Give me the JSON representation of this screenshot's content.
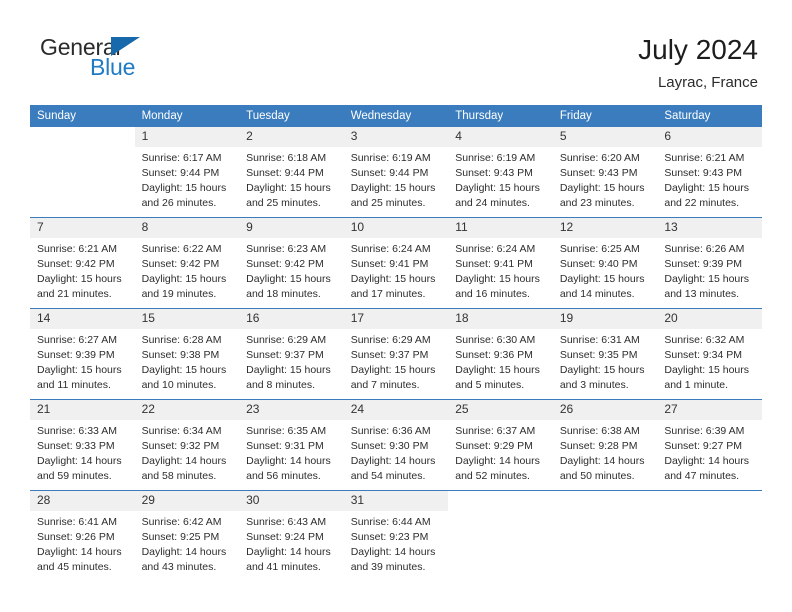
{
  "brand": {
    "name_part1": "General",
    "name_part2": "Blue"
  },
  "header": {
    "title": "July 2024",
    "location": "Layrac, France"
  },
  "colors": {
    "header_blue": "#3a7cbe",
    "logo_blue": "#1f7bc4",
    "daynum_bg": "#f0f0f0"
  },
  "weekday_headers": [
    "Sunday",
    "Monday",
    "Tuesday",
    "Wednesday",
    "Thursday",
    "Friday",
    "Saturday"
  ],
  "weeks": [
    [
      {
        "day": "",
        "sunrise": "",
        "sunset": "",
        "daylight": ""
      },
      {
        "day": "1",
        "sunrise": "Sunrise: 6:17 AM",
        "sunset": "Sunset: 9:44 PM",
        "daylight": "Daylight: 15 hours and 26 minutes."
      },
      {
        "day": "2",
        "sunrise": "Sunrise: 6:18 AM",
        "sunset": "Sunset: 9:44 PM",
        "daylight": "Daylight: 15 hours and 25 minutes."
      },
      {
        "day": "3",
        "sunrise": "Sunrise: 6:19 AM",
        "sunset": "Sunset: 9:44 PM",
        "daylight": "Daylight: 15 hours and 25 minutes."
      },
      {
        "day": "4",
        "sunrise": "Sunrise: 6:19 AM",
        "sunset": "Sunset: 9:43 PM",
        "daylight": "Daylight: 15 hours and 24 minutes."
      },
      {
        "day": "5",
        "sunrise": "Sunrise: 6:20 AM",
        "sunset": "Sunset: 9:43 PM",
        "daylight": "Daylight: 15 hours and 23 minutes."
      },
      {
        "day": "6",
        "sunrise": "Sunrise: 6:21 AM",
        "sunset": "Sunset: 9:43 PM",
        "daylight": "Daylight: 15 hours and 22 minutes."
      }
    ],
    [
      {
        "day": "7",
        "sunrise": "Sunrise: 6:21 AM",
        "sunset": "Sunset: 9:42 PM",
        "daylight": "Daylight: 15 hours and 21 minutes."
      },
      {
        "day": "8",
        "sunrise": "Sunrise: 6:22 AM",
        "sunset": "Sunset: 9:42 PM",
        "daylight": "Daylight: 15 hours and 19 minutes."
      },
      {
        "day": "9",
        "sunrise": "Sunrise: 6:23 AM",
        "sunset": "Sunset: 9:42 PM",
        "daylight": "Daylight: 15 hours and 18 minutes."
      },
      {
        "day": "10",
        "sunrise": "Sunrise: 6:24 AM",
        "sunset": "Sunset: 9:41 PM",
        "daylight": "Daylight: 15 hours and 17 minutes."
      },
      {
        "day": "11",
        "sunrise": "Sunrise: 6:24 AM",
        "sunset": "Sunset: 9:41 PM",
        "daylight": "Daylight: 15 hours and 16 minutes."
      },
      {
        "day": "12",
        "sunrise": "Sunrise: 6:25 AM",
        "sunset": "Sunset: 9:40 PM",
        "daylight": "Daylight: 15 hours and 14 minutes."
      },
      {
        "day": "13",
        "sunrise": "Sunrise: 6:26 AM",
        "sunset": "Sunset: 9:39 PM",
        "daylight": "Daylight: 15 hours and 13 minutes."
      }
    ],
    [
      {
        "day": "14",
        "sunrise": "Sunrise: 6:27 AM",
        "sunset": "Sunset: 9:39 PM",
        "daylight": "Daylight: 15 hours and 11 minutes."
      },
      {
        "day": "15",
        "sunrise": "Sunrise: 6:28 AM",
        "sunset": "Sunset: 9:38 PM",
        "daylight": "Daylight: 15 hours and 10 minutes."
      },
      {
        "day": "16",
        "sunrise": "Sunrise: 6:29 AM",
        "sunset": "Sunset: 9:37 PM",
        "daylight": "Daylight: 15 hours and 8 minutes."
      },
      {
        "day": "17",
        "sunrise": "Sunrise: 6:29 AM",
        "sunset": "Sunset: 9:37 PM",
        "daylight": "Daylight: 15 hours and 7 minutes."
      },
      {
        "day": "18",
        "sunrise": "Sunrise: 6:30 AM",
        "sunset": "Sunset: 9:36 PM",
        "daylight": "Daylight: 15 hours and 5 minutes."
      },
      {
        "day": "19",
        "sunrise": "Sunrise: 6:31 AM",
        "sunset": "Sunset: 9:35 PM",
        "daylight": "Daylight: 15 hours and 3 minutes."
      },
      {
        "day": "20",
        "sunrise": "Sunrise: 6:32 AM",
        "sunset": "Sunset: 9:34 PM",
        "daylight": "Daylight: 15 hours and 1 minute."
      }
    ],
    [
      {
        "day": "21",
        "sunrise": "Sunrise: 6:33 AM",
        "sunset": "Sunset: 9:33 PM",
        "daylight": "Daylight: 14 hours and 59 minutes."
      },
      {
        "day": "22",
        "sunrise": "Sunrise: 6:34 AM",
        "sunset": "Sunset: 9:32 PM",
        "daylight": "Daylight: 14 hours and 58 minutes."
      },
      {
        "day": "23",
        "sunrise": "Sunrise: 6:35 AM",
        "sunset": "Sunset: 9:31 PM",
        "daylight": "Daylight: 14 hours and 56 minutes."
      },
      {
        "day": "24",
        "sunrise": "Sunrise: 6:36 AM",
        "sunset": "Sunset: 9:30 PM",
        "daylight": "Daylight: 14 hours and 54 minutes."
      },
      {
        "day": "25",
        "sunrise": "Sunrise: 6:37 AM",
        "sunset": "Sunset: 9:29 PM",
        "daylight": "Daylight: 14 hours and 52 minutes."
      },
      {
        "day": "26",
        "sunrise": "Sunrise: 6:38 AM",
        "sunset": "Sunset: 9:28 PM",
        "daylight": "Daylight: 14 hours and 50 minutes."
      },
      {
        "day": "27",
        "sunrise": "Sunrise: 6:39 AM",
        "sunset": "Sunset: 9:27 PM",
        "daylight": "Daylight: 14 hours and 47 minutes."
      }
    ],
    [
      {
        "day": "28",
        "sunrise": "Sunrise: 6:41 AM",
        "sunset": "Sunset: 9:26 PM",
        "daylight": "Daylight: 14 hours and 45 minutes."
      },
      {
        "day": "29",
        "sunrise": "Sunrise: 6:42 AM",
        "sunset": "Sunset: 9:25 PM",
        "daylight": "Daylight: 14 hours and 43 minutes."
      },
      {
        "day": "30",
        "sunrise": "Sunrise: 6:43 AM",
        "sunset": "Sunset: 9:24 PM",
        "daylight": "Daylight: 14 hours and 41 minutes."
      },
      {
        "day": "31",
        "sunrise": "Sunrise: 6:44 AM",
        "sunset": "Sunset: 9:23 PM",
        "daylight": "Daylight: 14 hours and 39 minutes."
      },
      {
        "day": "",
        "sunrise": "",
        "sunset": "",
        "daylight": ""
      },
      {
        "day": "",
        "sunrise": "",
        "sunset": "",
        "daylight": ""
      },
      {
        "day": "",
        "sunrise": "",
        "sunset": "",
        "daylight": ""
      }
    ]
  ]
}
